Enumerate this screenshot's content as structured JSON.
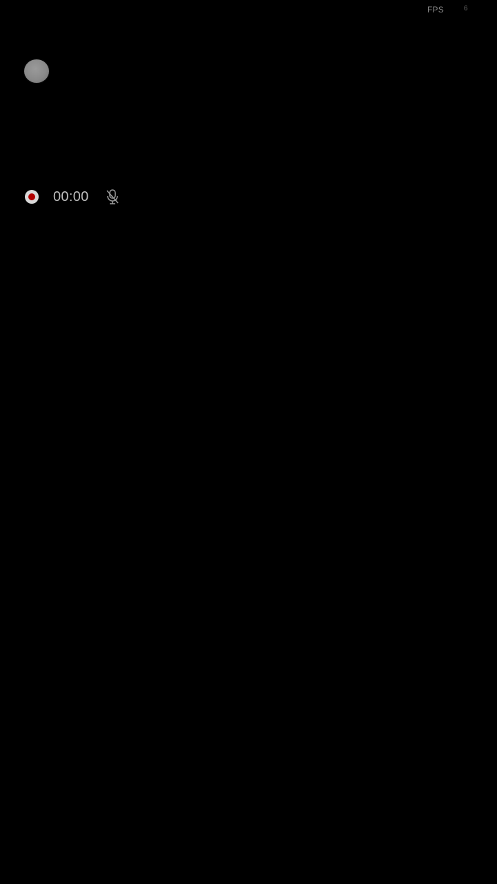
{
  "status_overlay": {
    "fps_label": "FPS",
    "fps_value": "6"
  },
  "floating_ball": {
    "icon": "floating-ball-icon"
  },
  "recorder": {
    "record_icon": "record-dot-icon",
    "elapsed_time": "00:00",
    "mic_icon": "mic-muted-icon"
  },
  "colors": {
    "background": "#000000",
    "record_red": "#b00000",
    "text_gray": "#bdbdbd"
  }
}
